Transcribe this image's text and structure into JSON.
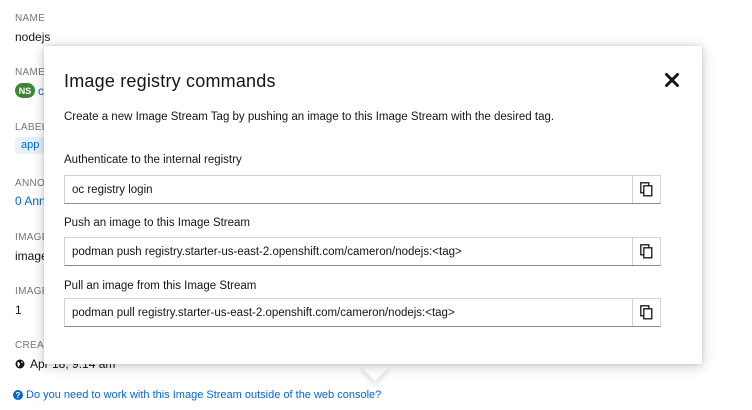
{
  "background": {
    "name_label": "NAME",
    "name_value": "nodejs",
    "namespace_label": "NAME",
    "namespace_badge": "NS",
    "namespace_link": "c",
    "labels_label": "LABEL",
    "label_chip": "app",
    "annotations_label": "ANNO",
    "annotations_link": "0 Ann",
    "image_repo_label": "IMAGE",
    "image_repo_value": "image",
    "image_count_label": "IMAGE",
    "image_count_value": "1",
    "created_label": "CREA",
    "created_value": "Apr 18, 9:14 am",
    "help_link": "Do you need to work with this Image Stream outside of the web console?"
  },
  "popover": {
    "title": "Image registry commands",
    "description": "Create a new Image Stream Tag by pushing an image to this Image Stream with the desired tag.",
    "sections": [
      {
        "label": "Authenticate to the internal registry",
        "command": "oc registry login"
      },
      {
        "label": "Push an image to this Image Stream",
        "command": "podman push registry.starter-us-east-2.openshift.com/cameron/nodejs:<tag>"
      },
      {
        "label": "Pull an image from this Image Stream",
        "command": "podman pull registry.starter-us-east-2.openshift.com/cameron/nodejs:<tag>"
      }
    ]
  },
  "icons": {
    "close": "close-icon",
    "copy": "copy-icon",
    "help": "question-circle-icon",
    "globe": "globe-icon"
  },
  "colors": {
    "link": "#0066cc",
    "namespace_badge": "#3e8635",
    "label_chip_bg": "#e7f1fa"
  }
}
